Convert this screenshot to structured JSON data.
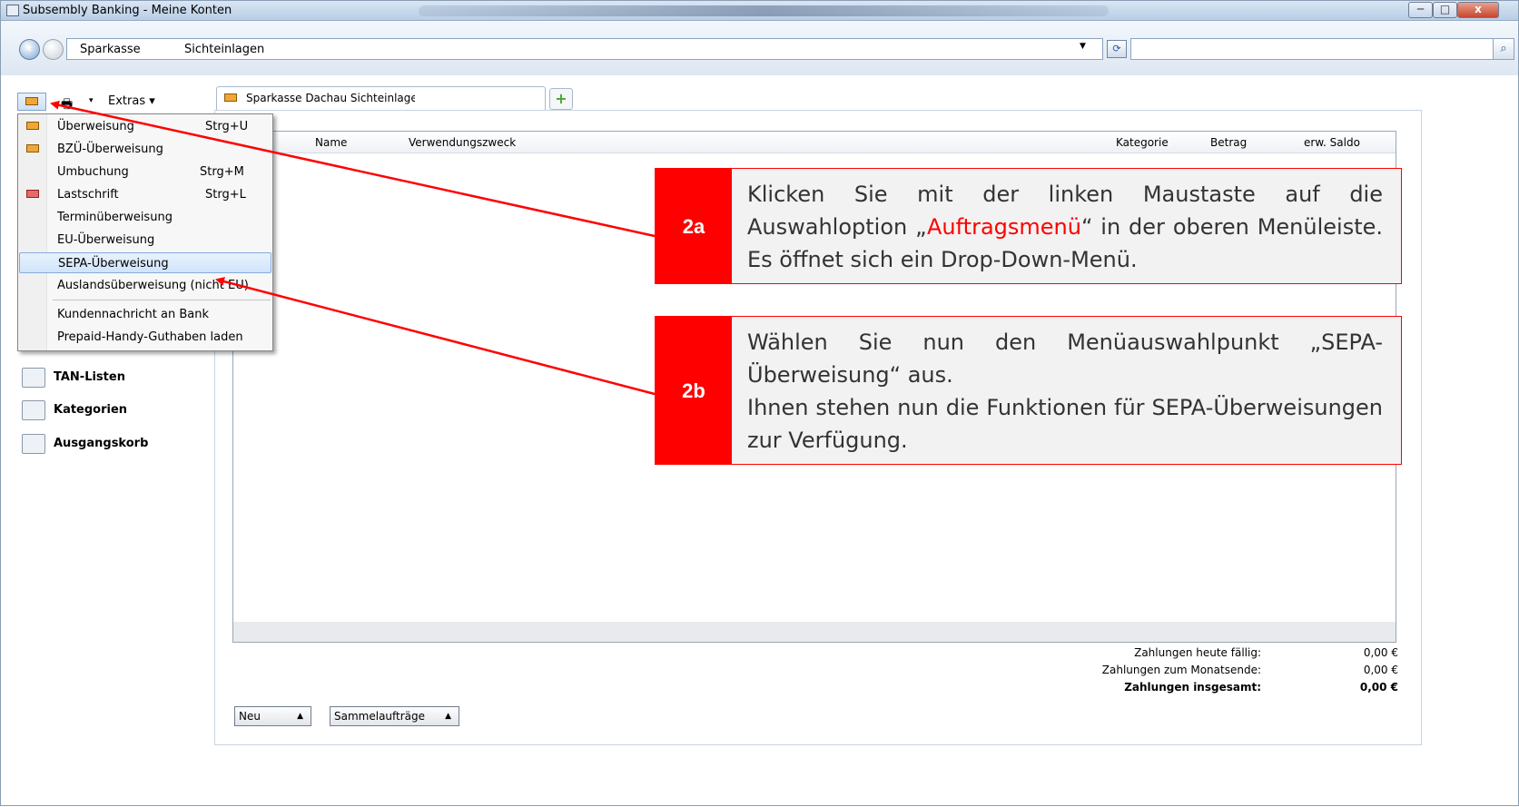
{
  "window": {
    "title": "Subsembly Banking - Meine Konten",
    "minimize": "─",
    "maximize": "□",
    "close": "x"
  },
  "address": {
    "crumb1": "Sparkasse",
    "crumb2": "Sichteinlagen",
    "dropdown_glyph": "▼",
    "refresh_glyph": "⟳",
    "search_glyph": "⌕"
  },
  "toolbar": {
    "extras_label": "Extras",
    "dropdown_glyph": "▾"
  },
  "tab": {
    "label": "Sparkasse Dachau Sichteinlagen",
    "add_glyph": "+"
  },
  "grid": {
    "columns": [
      "um",
      "Name",
      "Verwendungszweck",
      "Kategorie",
      "Betrag",
      "erw. Saldo"
    ]
  },
  "summary": {
    "rows": [
      {
        "label": "Zahlungen heute fällig:",
        "value": "0,00 €"
      },
      {
        "label": "Zahlungen zum Monatsende:",
        "value": "0,00 €"
      },
      {
        "label": "Zahlungen insgesamt:",
        "value": "0,00 €"
      }
    ]
  },
  "bottom_buttons": {
    "new_label": "Neu",
    "sammel_label": "Sammelaufträge",
    "arrow": "▲"
  },
  "sidebar": {
    "items": [
      {
        "label": "TAN-Listen"
      },
      {
        "label": "Kategorien"
      },
      {
        "label": "Ausgangskorb"
      }
    ]
  },
  "menu": {
    "items": [
      {
        "label": "Überweisung",
        "shortcut": "Strg+U"
      },
      {
        "label": "BZÜ-Überweisung",
        "shortcut": ""
      },
      {
        "label": "Umbuchung",
        "shortcut": "Strg+M"
      },
      {
        "label": "Lastschrift",
        "shortcut": "Strg+L"
      },
      {
        "label": "Terminüberweisung",
        "shortcut": ""
      },
      {
        "label": "EU-Überweisung",
        "shortcut": ""
      },
      {
        "label": "SEPA-Überweisung",
        "shortcut": ""
      },
      {
        "label": "Auslandsüberweisung (nicht EU)",
        "shortcut": ""
      },
      {
        "label": "Kundennachricht an Bank",
        "shortcut": ""
      },
      {
        "label": "Prepaid-Handy-Guthaben laden",
        "shortcut": ""
      }
    ]
  },
  "callouts": {
    "a": {
      "number": "2a",
      "text_before": "Klicken Sie mit der linken Maustaste auf die Auswahloption „",
      "highlight": "Auftragsmenü",
      "text_after": "“ in der oberen Menüleiste. Es öffnet sich ein Drop-Down-Menü."
    },
    "b": {
      "number": "2b",
      "line1": "Wählen Sie nun den Menüauswahlpunkt „SEPA-Überweisung“ aus.",
      "line2": "Ihnen stehen nun die Funktionen für SEPA-Überweisungen zur Verfügung."
    }
  },
  "colors": {
    "accent_red": "#ff0000",
    "highlight_blue": "#cfe4fb"
  }
}
